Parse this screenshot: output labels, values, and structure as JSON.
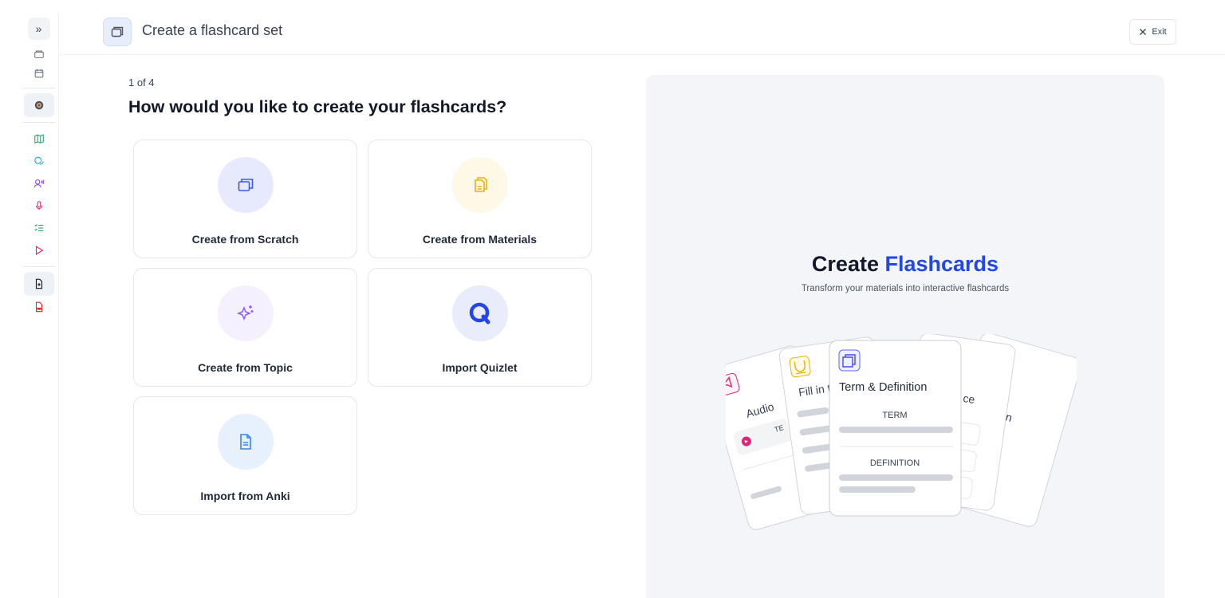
{
  "header": {
    "title": "Create a flashcard set",
    "exit_label": "Exit"
  },
  "sidebar": {
    "toggle": "»",
    "items": [
      "folder-icon",
      "calendar-icon",
      "avatar",
      "map-icon",
      "chat-icon",
      "voice-user-icon",
      "microphone-icon",
      "checklist-icon",
      "play-icon",
      "file-add-icon",
      "pdf-icon"
    ]
  },
  "main": {
    "step": "1 of 4",
    "question": "How would you like to create your flashcards?",
    "options": [
      {
        "label": "Create from Scratch",
        "icon": "flashcards-icon",
        "color": "#e7eafd"
      },
      {
        "label": "Create from Materials",
        "icon": "documents-icon",
        "color": "#fef9e7"
      },
      {
        "label": "Create from Topic",
        "icon": "sparkle-icon",
        "color": "#f5f0fd"
      },
      {
        "label": "Import Quizlet",
        "icon": "quizlet-icon",
        "color": "#e8ecfb"
      },
      {
        "label": "Import from Anki",
        "icon": "document-icon",
        "color": "#e7f0fd"
      }
    ]
  },
  "panel": {
    "title_prefix": "Create",
    "title_accent": "Flashcards",
    "accent_color": "#2347e6",
    "subtitle": "Transform your materials into interactive flashcards",
    "cards": {
      "audio": "Audio",
      "audio_te": "TE",
      "fill": "Fill in t",
      "term_def": "Term & Definition",
      "term": "TERM",
      "definition": "DEFINITION",
      "choice": "ce",
      "other": "n"
    }
  }
}
